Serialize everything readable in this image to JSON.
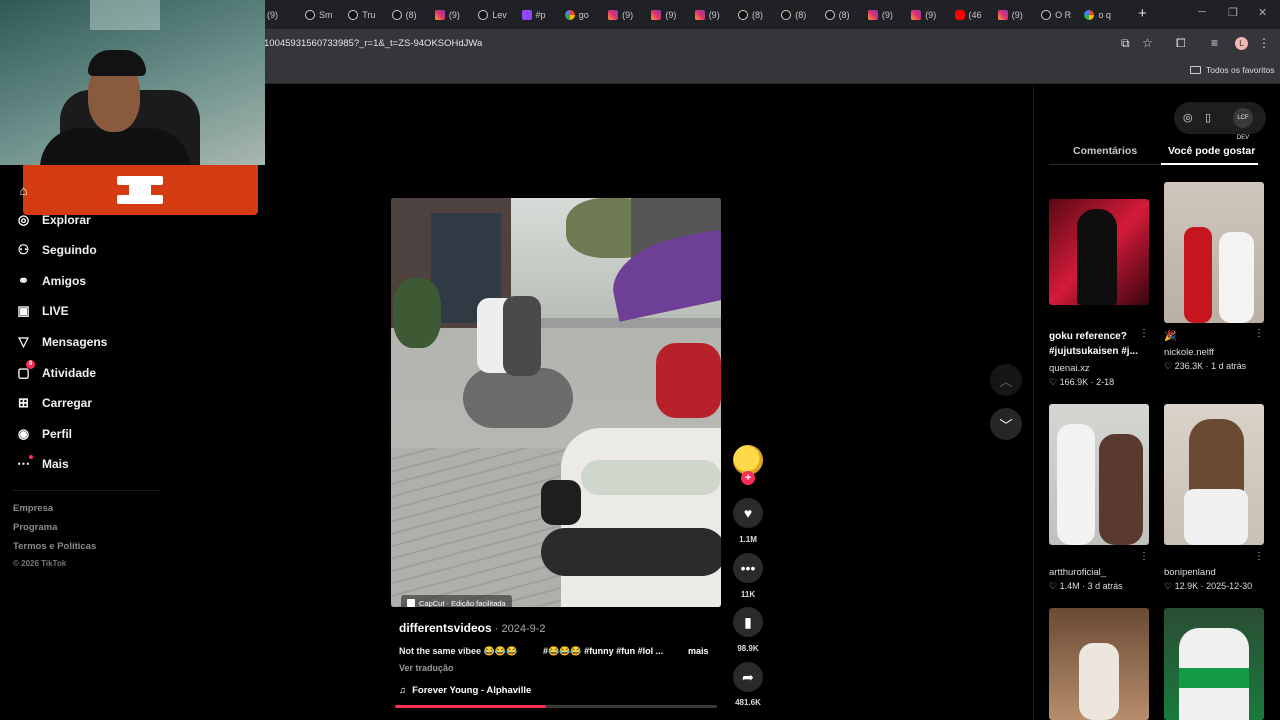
{
  "browser": {
    "tabs": [
      {
        "label": "(9)",
        "icon": "tiktok"
      },
      {
        "label": "Sm",
        "icon": "tiktok"
      },
      {
        "label": "Tru",
        "icon": "tiktok"
      },
      {
        "label": "(8)",
        "icon": "tiktok"
      },
      {
        "label": "(9)",
        "icon": "instagram"
      },
      {
        "label": "Lev",
        "icon": "tiktok"
      },
      {
        "label": "#p",
        "icon": "twitch"
      },
      {
        "label": "go",
        "icon": "google"
      },
      {
        "label": "(9)",
        "icon": "instagram"
      },
      {
        "label": "(9)",
        "icon": "instagram"
      },
      {
        "label": "(9)",
        "icon": "instagram"
      },
      {
        "label": "(8)",
        "icon": "tiktok"
      },
      {
        "label": "(8)",
        "icon": "tiktok"
      },
      {
        "label": "(8)",
        "icon": "tiktok"
      },
      {
        "label": "(9)",
        "icon": "instagram"
      },
      {
        "label": "(9)",
        "icon": "instagram"
      },
      {
        "label": "(46",
        "icon": "youtube"
      },
      {
        "label": "(9)",
        "icon": "instagram"
      },
      {
        "label": "O R",
        "icon": "tiktok"
      },
      {
        "label": "o q",
        "icon": "google"
      }
    ],
    "new_tab": "+",
    "url": "10045931560733985?_r=1&_t=ZS-94OKSOHdJWa",
    "profile_initial": "L",
    "bookmarks_folder": "Todos os favoritos"
  },
  "overlay": {
    "color": "#d53b10"
  },
  "nav": {
    "items": [
      {
        "label": "Explorar",
        "icon": "compass-icon"
      },
      {
        "label": "Seguindo",
        "icon": "user-follow-icon"
      },
      {
        "label": "Amigos",
        "icon": "friends-icon"
      },
      {
        "label": "LIVE",
        "icon": "live-icon"
      },
      {
        "label": "Mensagens",
        "icon": "message-icon"
      },
      {
        "label": "Atividade",
        "icon": "activity-icon",
        "badge": "8"
      },
      {
        "label": "Carregar",
        "icon": "upload-icon"
      },
      {
        "label": "Perfil",
        "icon": "profile-icon"
      },
      {
        "label": "Mais",
        "icon": "more-icon"
      }
    ],
    "footer": [
      "Empresa",
      "Programa",
      "Termos e Políticas"
    ],
    "copyright": "© 2026 TikTok"
  },
  "video": {
    "capcut_label": "CapCut · Edição facilitada",
    "creator": "differentsvideos",
    "date": " · 2024-9-2",
    "caption": "Not the same vibee 😂😂😂",
    "tags": "#😂😂😂 #funny #fun #lol ...",
    "more": "mais",
    "translate": "Ver tradução",
    "music": "Forever Young - Alphaville",
    "progress": 0.47,
    "accent": "#fe2c55"
  },
  "actions": {
    "follow": "+",
    "likes": "1.1M",
    "comments": "11K",
    "saves": "98.9K",
    "shares": "481.6K"
  },
  "right_panel": {
    "tabs": [
      "Comentários",
      "Você pode gostar"
    ],
    "active_tab": "Você pode gostar",
    "avatar_label": "LCF DEV",
    "thumbs": [
      {
        "title": "goku reference? #jujutsukaisen #j...",
        "user": "quenai.xz",
        "likes": "166.9K",
        "date": "2-18"
      },
      {
        "title": "🎉",
        "user": "nickole.nelff",
        "likes": "236.3K",
        "date": "1 d atrás"
      },
      {
        "title": "",
        "user": "artthuroficial_",
        "likes": "1.4M",
        "date": "3 d atrás"
      },
      {
        "title": "",
        "user": "bonipenland",
        "likes": "12.9K",
        "date": "2025-12-30"
      },
      {
        "title": "",
        "user": "",
        "likes": "",
        "date": ""
      },
      {
        "title": "",
        "user": "",
        "likes": "",
        "date": ""
      }
    ]
  }
}
